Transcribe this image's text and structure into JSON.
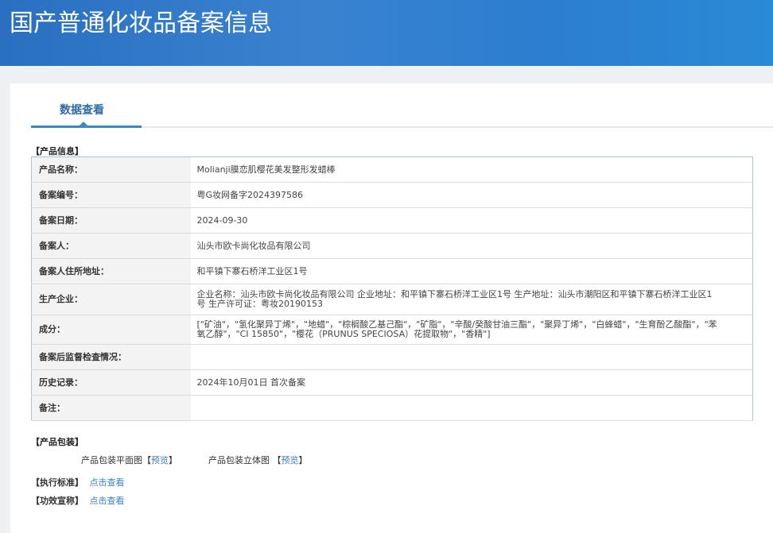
{
  "header": {
    "title": "国产普通化妆品备案信息"
  },
  "tabs": [
    {
      "label": "数据查看"
    }
  ],
  "product_info": {
    "section_title": "【产品信息】",
    "rows": [
      {
        "label": "产品名称：",
        "value": "Molianji膜恋肌樱花美发整形发蜡棒"
      },
      {
        "label": "备案编号：",
        "value": "粤G妆网备字2024397586"
      },
      {
        "label": "备案日期：",
        "value": "2024-09-30"
      },
      {
        "label": "备案人：",
        "value": "汕头市欧卡尚化妆品有限公司"
      },
      {
        "label": "备案人住所地址：",
        "value": "和平镇下寨石桥洋工业区1号"
      },
      {
        "label": "生产企业：",
        "value": "企业名称：汕头市欧卡尚化妆品有限公司 企业地址：和平镇下寨石桥洋工业区1号 生产地址：汕头市潮阳区和平镇下寨石桥洋工业区1号 生产许可证：粤妆20190153"
      },
      {
        "label": "成分：",
        "value": "[\"矿油\"，\"氢化聚异丁烯\"，\"地蜡\"，\"棕榈酸乙基己酯\"，\"矿脂\"，\"辛酸/癸酸甘油三酯\"，\"聚异丁烯\"，\"白蜂蜡\"，\"生育酚乙酸酯\"，\"苯氧乙醇\"，\"CI 15850\"，\"樱花（PRUNUS SPECIOSA）花提取物\"，\"香精\"]"
      },
      {
        "label": "备案后监督检查情况：",
        "value": ""
      },
      {
        "label": "历史记录：",
        "value": "2024年10月01日 首次备案"
      },
      {
        "label": "备注：",
        "value": ""
      }
    ]
  },
  "packaging": {
    "section_title": "【产品包装】",
    "flat_label": "产品包装平面图",
    "solid_label": "产品包装立体图",
    "bracket_open": "【",
    "bracket_close": "】",
    "preview": "预览"
  },
  "standard": {
    "label": "【执行标准】",
    "link": "点击查看"
  },
  "efficacy": {
    "label": "【功效宣称】",
    "link": "点击查看"
  },
  "colors": {
    "header": "#2c7bcf",
    "accent": "#3d86c6",
    "link": "#3b7fc0"
  }
}
